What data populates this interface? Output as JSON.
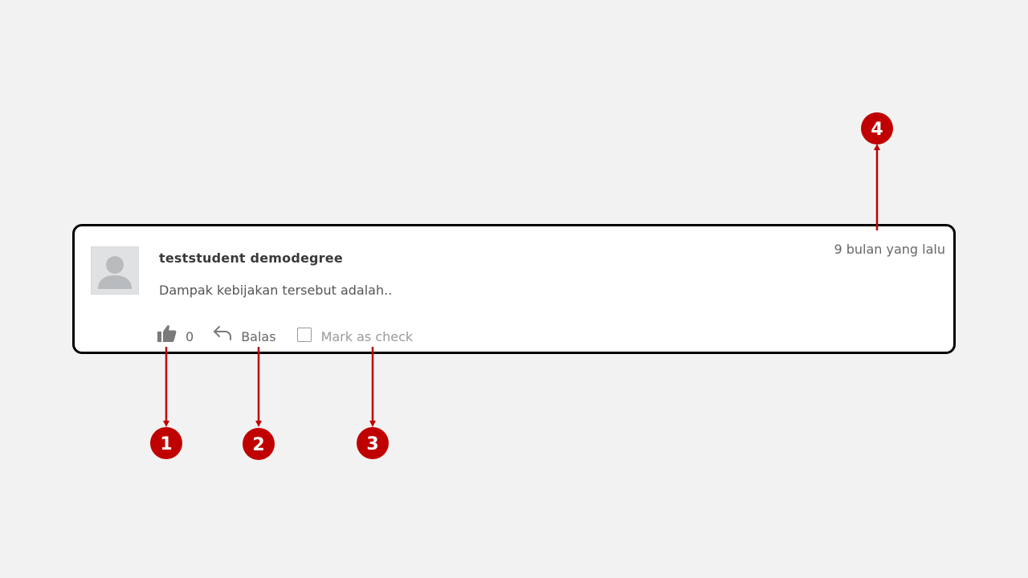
{
  "comment": {
    "author": "teststudent demodegree",
    "body": "Dampak kebijakan tersebut adalah..",
    "timestamp": "9 bulan yang lalu",
    "like_count": "0",
    "reply_label": "Balas",
    "mark_check_label": "Mark as check",
    "mark_check_checked": false
  },
  "icons": {
    "avatar": "user-silhouette-icon",
    "like": "thumbs-up-icon",
    "reply": "reply-arrow-icon",
    "checkbox": "checkbox-icon"
  },
  "annotations": {
    "markers": [
      "1",
      "2",
      "3",
      "4"
    ],
    "color": "#c00000"
  },
  "colors": {
    "background": "#f2f2f2",
    "card": "#ffffff",
    "card_border": "#000000",
    "text_primary": "#3a3a3a",
    "text_secondary": "#666666",
    "text_muted": "#9a9a9a"
  }
}
